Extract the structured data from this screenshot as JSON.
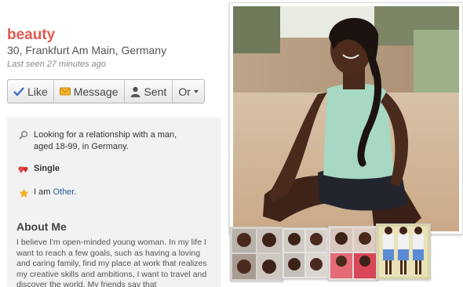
{
  "profile": {
    "name": "beauty",
    "location": "30, Frankfurt Am Main, Germany",
    "last_seen": "Last seen 27 minutes ago"
  },
  "actions": {
    "like": "Like",
    "message": "Message",
    "sent": "Sent",
    "more": "Or"
  },
  "details": {
    "looking_for": "Looking for a relationship with a man, aged 18-99, in Germany.",
    "status": "Single",
    "identity_prefix": "I am ",
    "identity_link": "Other",
    "identity_suffix": "."
  },
  "about": {
    "title": "About Me",
    "text": "I believe I'm open-minded young woman. In my life I want to reach a few goals, such as having a loving and caring family, find my place at work that realizes my creative skills and ambitions, I want to travel and discover the world. My friends say that"
  },
  "colors": {
    "name": "#e05a50",
    "link": "#2b5d9c",
    "like_check": "#3a6fc4",
    "heart": "#e0474c",
    "star": "#f2b01e"
  },
  "icons": [
    "check-icon",
    "envelope-icon",
    "person-icon",
    "chevron-down-icon",
    "magnifier-icon",
    "hearts-icon",
    "star-icon"
  ]
}
